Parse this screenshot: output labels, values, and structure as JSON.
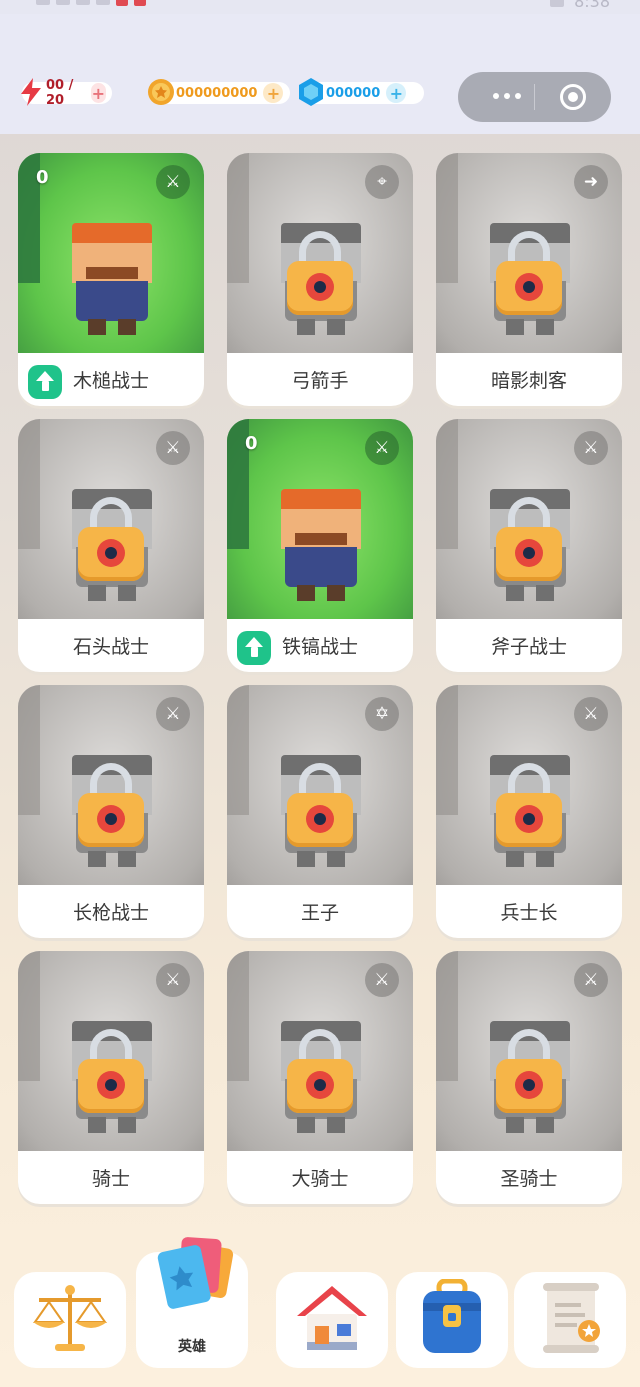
{
  "status": {
    "time": "8:38"
  },
  "resources": {
    "energy": {
      "value": "00 / 20",
      "icon": "lightning-icon",
      "color": "#e63a44"
    },
    "coins": {
      "value": "000000000",
      "icon": "coin-icon",
      "color": "#ef9a1d"
    },
    "gems": {
      "value": "000000",
      "icon": "gem-icon",
      "color": "#1a9ee8"
    }
  },
  "capsule": {
    "more": "more-icon",
    "close": "target-icon"
  },
  "heroes": [
    {
      "name": "木槌战士",
      "count": "0",
      "locked": false,
      "upgrade": true,
      "role_icon": "sword-icon",
      "role_glyph": "⚔"
    },
    {
      "name": "弓箭手",
      "count": "",
      "locked": true,
      "upgrade": false,
      "role_icon": "crosshair-icon",
      "role_glyph": "⌖"
    },
    {
      "name": "暗影刺客",
      "count": "",
      "locked": true,
      "upgrade": false,
      "role_icon": "dash-icon",
      "role_glyph": "➜"
    },
    {
      "name": "石头战士",
      "count": "",
      "locked": true,
      "upgrade": false,
      "role_icon": "sword-icon",
      "role_glyph": "⚔"
    },
    {
      "name": "铁镐战士",
      "count": "0",
      "locked": false,
      "upgrade": true,
      "role_icon": "sword-icon",
      "role_glyph": "⚔"
    },
    {
      "name": "斧子战士",
      "count": "",
      "locked": true,
      "upgrade": false,
      "role_icon": "sword-icon",
      "role_glyph": "⚔"
    },
    {
      "name": "长枪战士",
      "count": "",
      "locked": true,
      "upgrade": false,
      "role_icon": "spear-icon",
      "role_glyph": "⚔"
    },
    {
      "name": "王子",
      "count": "",
      "locked": true,
      "upgrade": false,
      "role_icon": "star-ring-icon",
      "role_glyph": "✡"
    },
    {
      "name": "兵士长",
      "count": "",
      "locked": true,
      "upgrade": false,
      "role_icon": "sword-icon",
      "role_glyph": "⚔"
    },
    {
      "name": "骑士",
      "count": "",
      "locked": true,
      "upgrade": false,
      "role_icon": "sword-icon",
      "role_glyph": "⚔"
    },
    {
      "name": "大骑士",
      "count": "",
      "locked": true,
      "upgrade": false,
      "role_icon": "sword-icon",
      "role_glyph": "⚔"
    },
    {
      "name": "圣骑士",
      "count": "",
      "locked": true,
      "upgrade": false,
      "role_icon": "sword-icon",
      "role_glyph": "⚔"
    }
  ],
  "nav": [
    {
      "id": "balance",
      "label": "",
      "icon": "balance-scale-icon"
    },
    {
      "id": "heroes",
      "label": "英雄",
      "icon": "hero-cards-icon",
      "active": true
    },
    {
      "id": "home",
      "label": "",
      "icon": "home-icon"
    },
    {
      "id": "bag",
      "label": "",
      "icon": "backpack-icon"
    },
    {
      "id": "quest",
      "label": "",
      "icon": "scroll-icon"
    }
  ]
}
